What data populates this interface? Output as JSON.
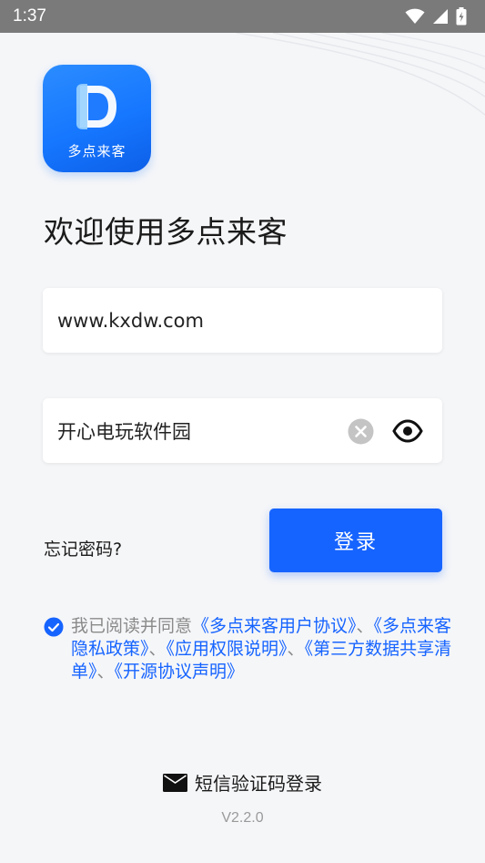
{
  "status_bar": {
    "time": "1:37"
  },
  "app": {
    "logo_text": "多点来客",
    "welcome": "欢迎使用多点来客"
  },
  "form": {
    "account_value": "www.kxdw.com",
    "password_value": "开心电玩软件园",
    "forgot_label": "忘记密码?",
    "login_label": "登录"
  },
  "agreement": {
    "prefix": "我已阅读并同意",
    "links": [
      "《多点来客用户协议》",
      "《多点来客隐私政策》",
      "《应用权限说明》",
      "《第三方数据共享清单》",
      "《开源协议声明》"
    ],
    "sep": "、",
    "checked": true
  },
  "footer": {
    "sms_login_label": "短信验证码登录",
    "version": "V2.2.0"
  },
  "colors": {
    "brand": "#1664ff",
    "background": "#f5f6f8"
  }
}
